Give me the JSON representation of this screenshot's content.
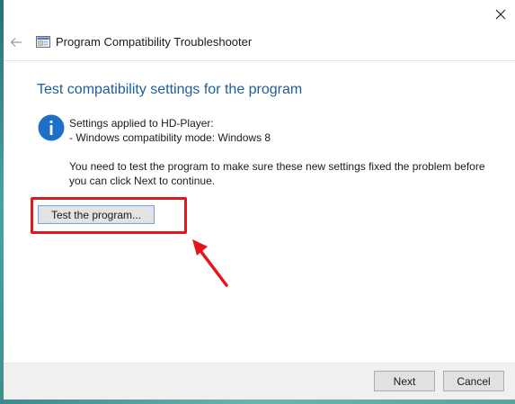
{
  "window": {
    "title": "Program Compatibility Troubleshooter",
    "close_icon": "close-icon",
    "back_icon": "back-arrow-icon"
  },
  "main": {
    "heading": "Test compatibility settings for the program",
    "settings_line1": "Settings applied to HD-Player:",
    "settings_line2": "- Windows compatibility mode: Windows 8",
    "instruction_line1": "You need to test the program to make sure these new settings fixed the problem before",
    "instruction_line2": "you can click Next to continue.",
    "test_button_label": "Test the program..."
  },
  "footer": {
    "next_label": "Next",
    "cancel_label": "Cancel"
  },
  "colors": {
    "heading": "#1e5d9c",
    "info_icon": "#1e6fc8",
    "annotation_red": "#e3161c",
    "footer_bg": "#f0f0f0"
  }
}
